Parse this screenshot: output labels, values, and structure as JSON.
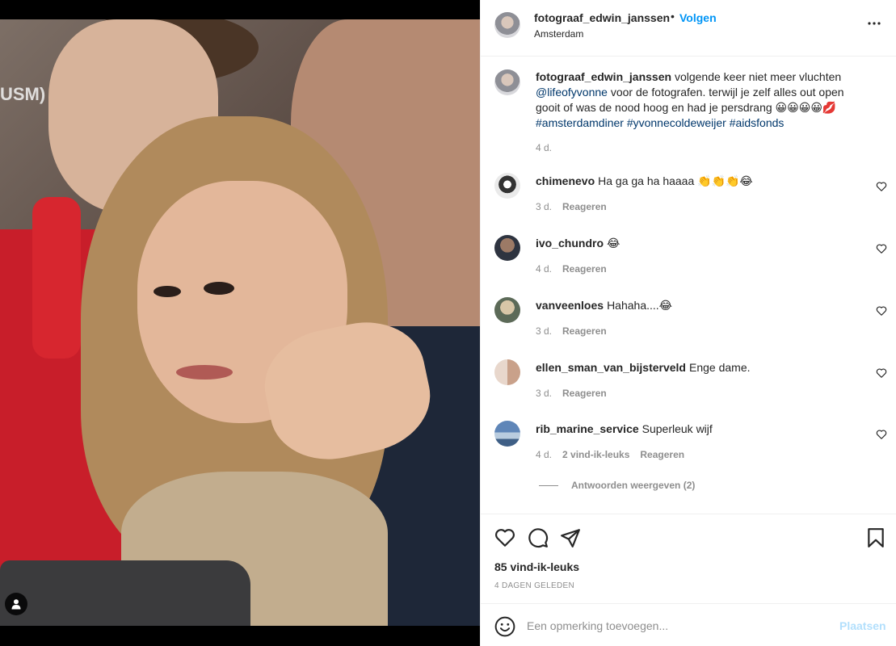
{
  "header": {
    "username": "fotograaf_edwin_janssen",
    "separator": "•",
    "follow_label": "Volgen",
    "location": "Amsterdam",
    "more_icon": "more-horizontal-icon"
  },
  "photo": {
    "visible_sign_text": "USM)",
    "user_tag_icon": "person-icon"
  },
  "caption": {
    "username": "fotograaf_edwin_janssen",
    "text_1": "volgende keer niet meer vluchten",
    "mention": "@lifeofyvonne",
    "text_2": "voor de fotografen. terwijl je zelf alles out open gooit of was de nood hoog en had je persdrang 😀😀😀😀💋",
    "hashtags": [
      "#amsterdamdiner",
      "#yvonnecoldeweijer",
      "#aidsfonds"
    ],
    "time": "4 d."
  },
  "comments": [
    {
      "username": "chimenevo",
      "text": "Ha ga ga ha haaaa 👏👏👏😂",
      "time": "3 d.",
      "likes": "",
      "reply_label": "Reageren"
    },
    {
      "username": "ivo_chundro",
      "text": "😂",
      "time": "4 d.",
      "likes": "",
      "reply_label": "Reageren"
    },
    {
      "username": "vanveenloes",
      "text": "Hahaha....😂",
      "time": "3 d.",
      "likes": "",
      "reply_label": "Reageren"
    },
    {
      "username": "ellen_sman_van_bijsterveld",
      "text": "Enge dame.",
      "time": "3 d.",
      "likes": "",
      "reply_label": "Reageren"
    },
    {
      "username": "rib_marine_service",
      "text": "Superleuk wijf",
      "time": "4 d.",
      "likes": "2 vind-ik-leuks",
      "reply_label": "Reageren"
    }
  ],
  "replies_toggle": "Antwoorden weergeven (2)",
  "actions": {
    "like_icon": "heart-icon",
    "comment_icon": "comment-icon",
    "share_icon": "send-icon",
    "save_icon": "bookmark-icon",
    "likes_count": "85 vind-ik-leuks",
    "posted_date": "4 DAGEN GELEDEN"
  },
  "add_comment": {
    "emoji_icon": "smiley-icon",
    "placeholder": "Een opmerking toevoegen...",
    "post_label": "Plaatsen"
  },
  "colors": {
    "accent": "#0095f6",
    "link": "#00376b",
    "muted": "#8e8e8e",
    "post_disabled": "#b2dffc"
  }
}
